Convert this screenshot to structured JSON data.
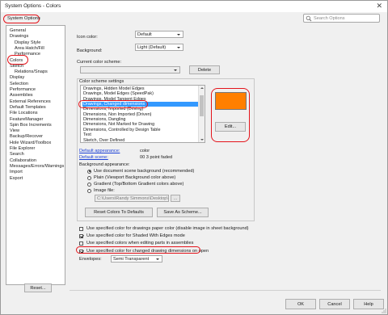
{
  "window": {
    "title": "System Options - Colors",
    "close_glyph": "✕"
  },
  "tab": {
    "label": "System Options"
  },
  "search": {
    "placeholder": "Search Options"
  },
  "nav": {
    "items": [
      {
        "label": "General",
        "sub": false
      },
      {
        "label": "Drawings",
        "sub": false
      },
      {
        "label": "Display Style",
        "sub": true
      },
      {
        "label": "Area Hatch/Fill",
        "sub": true
      },
      {
        "label": "Performance",
        "sub": true
      },
      {
        "label": "Colors",
        "sub": false
      },
      {
        "label": "Sketch",
        "sub": false
      },
      {
        "label": "Relations/Snaps",
        "sub": true
      },
      {
        "label": "Display",
        "sub": false
      },
      {
        "label": "Selection",
        "sub": false
      },
      {
        "label": "Performance",
        "sub": false
      },
      {
        "label": "Assemblies",
        "sub": false
      },
      {
        "label": "External References",
        "sub": false
      },
      {
        "label": "Default Templates",
        "sub": false
      },
      {
        "label": "File Locations",
        "sub": false
      },
      {
        "label": "FeatureManager",
        "sub": false
      },
      {
        "label": "Spin Box Increments",
        "sub": false
      },
      {
        "label": "View",
        "sub": false
      },
      {
        "label": "Backup/Recover",
        "sub": false
      },
      {
        "label": "Hole Wizard/Toolbox",
        "sub": false
      },
      {
        "label": "File Explorer",
        "sub": false
      },
      {
        "label": "Search",
        "sub": false
      },
      {
        "label": "Collaboration",
        "sub": false
      },
      {
        "label": "Messages/Errors/Warnings",
        "sub": false
      },
      {
        "label": "Import",
        "sub": false
      },
      {
        "label": "Export",
        "sub": false
      }
    ],
    "reset_label": "Reset..."
  },
  "main": {
    "icon_color_label": "Icon color:",
    "icon_color_value": "Default",
    "background_label": "Background:",
    "background_value": "Light (Default)",
    "current_scheme_label": "Current color scheme:",
    "current_scheme_value": "",
    "delete_label": "Delete",
    "scheme_settings_label": "Color scheme settings",
    "scheme_items": [
      "Drawings, Hidden Model Edges",
      "Drawings, Model Edges (SpeedPak)",
      "Drawings, Model Tangent Edges",
      "Drawings, Changed dimensions",
      "Dimensions, Imported (Driving)",
      "Dimensions, Non Imported (Driven)",
      "Dimensions, Dangling",
      "Dimensions, Not Marked for Drawing",
      "Dimensions, Controlled by Design Table",
      "Text",
      "Sketch, Over Defined"
    ],
    "selected_index": 3,
    "edit_label": "Edit...",
    "default_appearance_link": "Default appearance:",
    "default_appearance_value": "color",
    "default_scene_link": "Default scene:",
    "default_scene_value": "00 3 point faded",
    "bg_appearance_label": "Background appearance:",
    "radios": [
      {
        "label": "Use document scene background (recommended)",
        "checked": true
      },
      {
        "label": "Plain (Viewport Background color above)",
        "checked": false
      },
      {
        "label": "Gradient (Top/Bottom Gradient colors above)",
        "checked": false
      },
      {
        "label": "Image file:",
        "checked": false
      }
    ],
    "image_path": "C:\\Users\\Randy Simmons\\Desktop\\IMG_20150707",
    "browse_label": "...",
    "reset_colors_label": "Reset Colors To Defaults",
    "save_scheme_label": "Save As Scheme...",
    "checkboxes": [
      {
        "label": "Use specified color for drawings paper color (disable image in sheet background)",
        "checked": false
      },
      {
        "label": "Use specified color for Shaded With Edges mode",
        "checked": true
      },
      {
        "label": "Use specified colors when editing parts in assemblies",
        "checked": false
      },
      {
        "label": "Use specified color for changed drawing dimensions on open",
        "checked": true
      }
    ],
    "envelopes_label": "Envelopes:",
    "envelopes_value": "Semi Transparent"
  },
  "footer": {
    "ok": "OK",
    "cancel": "Cancel",
    "help": "Help"
  },
  "colors": {
    "swatch": "#ff7f00",
    "highlight": "#e4141b",
    "selection": "#3399ff"
  }
}
